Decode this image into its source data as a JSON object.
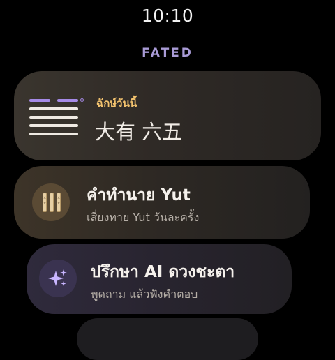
{
  "status": {
    "time": "10:10"
  },
  "app": {
    "title": "FATED"
  },
  "hexagram_card": {
    "label": "ฉักษ์วันนี้",
    "name": "大有 六五",
    "colors": {
      "yang": "#efeae3",
      "yin": "#a58ae6",
      "label": "#f2c26e"
    }
  },
  "yut_card": {
    "title": "คำทำนาย Yut",
    "subtitle": "เสี่ยงทาย Yut วันละครั้ง"
  },
  "ai_card": {
    "title": "ปรึกษา AI ดวงชะตา",
    "subtitle": "พูดถาม แล้วฟังคำตอบ"
  },
  "icons": {
    "hexagram": "hexagram-icon",
    "yut": "yut-sticks-icon",
    "ai": "sparkle-icon"
  }
}
